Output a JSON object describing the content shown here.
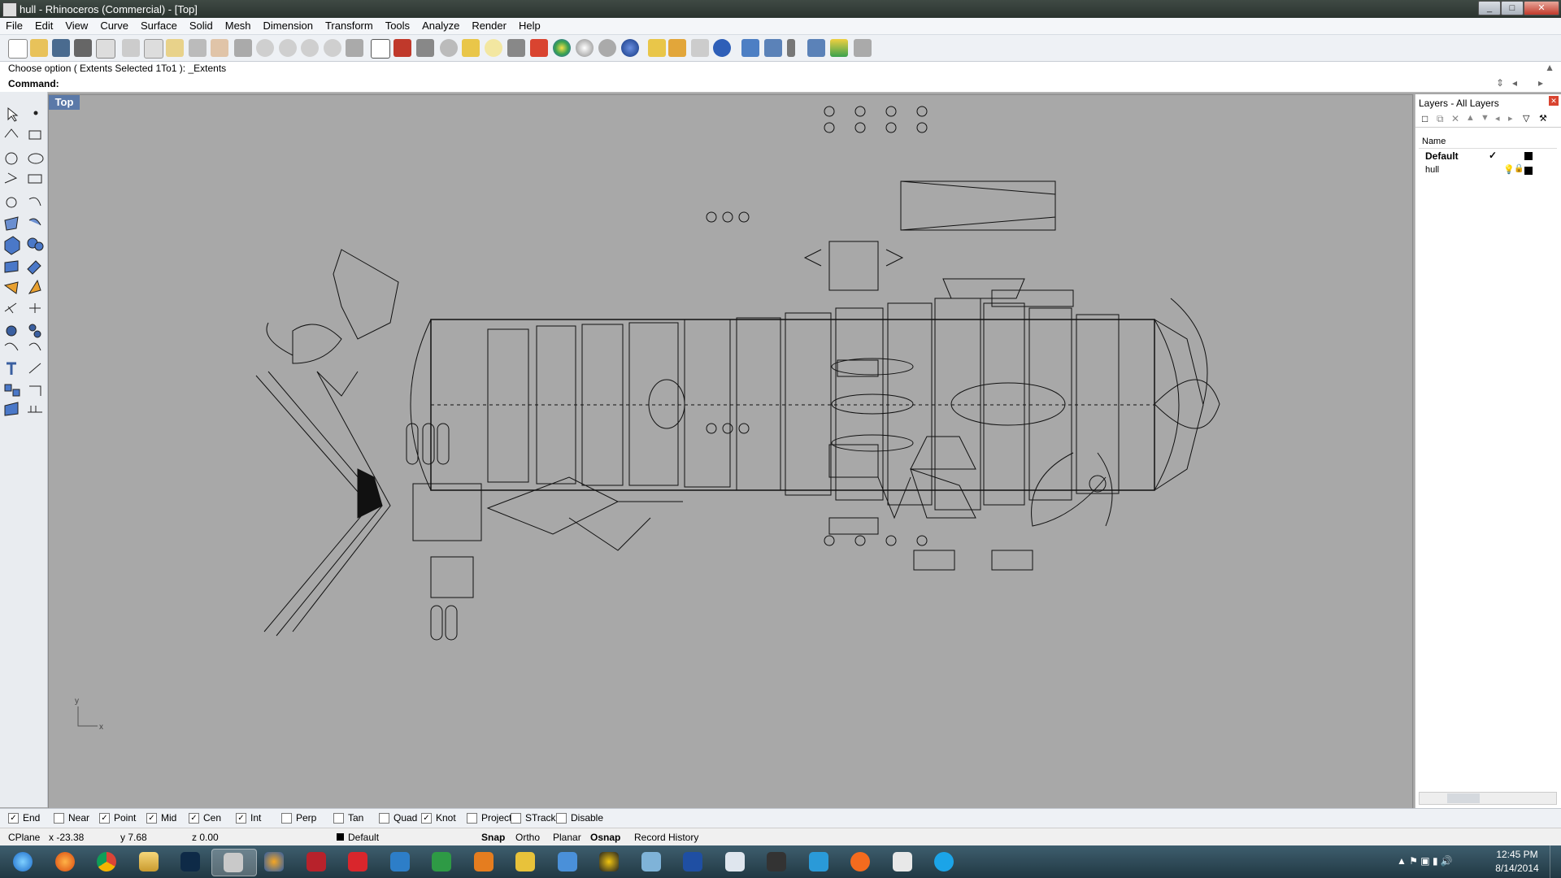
{
  "window": {
    "title": "hull - Rhinoceros (Commercial) - [Top]"
  },
  "menu": [
    "File",
    "Edit",
    "View",
    "Curve",
    "Surface",
    "Solid",
    "Mesh",
    "Dimension",
    "Transform",
    "Tools",
    "Analyze",
    "Render",
    "Help"
  ],
  "command": {
    "history": "Choose option ( Extents  Selected  1To1 ): _Extents",
    "prompt": "Command:"
  },
  "viewport": {
    "label": "Top",
    "axis_x": "x",
    "axis_y": "y"
  },
  "layers": {
    "title": "Layers - All Layers",
    "column_name": "Name",
    "rows": [
      {
        "name": "Default",
        "current_mark": "✓"
      },
      {
        "name": "hull"
      }
    ]
  },
  "osnap": [
    {
      "label": "End",
      "checked": true
    },
    {
      "label": "Near",
      "checked": false
    },
    {
      "label": "Point",
      "checked": true
    },
    {
      "label": "Mid",
      "checked": true
    },
    {
      "label": "Cen",
      "checked": true
    },
    {
      "label": "Int",
      "checked": true
    },
    {
      "label": "Perp",
      "checked": false
    },
    {
      "label": "Tan",
      "checked": false
    },
    {
      "label": "Quad",
      "checked": false
    },
    {
      "label": "Knot",
      "checked": true
    },
    {
      "label": "Project",
      "checked": false
    },
    {
      "label": "STrack",
      "checked": false
    },
    {
      "label": "Disable",
      "checked": false
    }
  ],
  "status": {
    "cplane": "CPlane",
    "x": "x -23.38",
    "y": "y 7.68",
    "z": "z 0.00",
    "layer": "Default",
    "snap": "Snap",
    "ortho": "Ortho",
    "planar": "Planar",
    "osnap": "Osnap",
    "record_history": "Record History"
  },
  "clock": {
    "time": "12:45 PM",
    "date": "8/14/2014"
  },
  "taskbar_apps": [
    "windows-start",
    "firefox",
    "chrome",
    "file-explorer",
    "photoshop",
    "rhinoceros",
    "blender",
    "app-red",
    "sketchup-red",
    "app-blue-bird",
    "app-green",
    "media-player",
    "app-yellow",
    "app-people",
    "app-eye",
    "app-blue-box",
    "word",
    "calculator",
    "app-dark",
    "uplay",
    "origin",
    "sketchup",
    "skype"
  ]
}
